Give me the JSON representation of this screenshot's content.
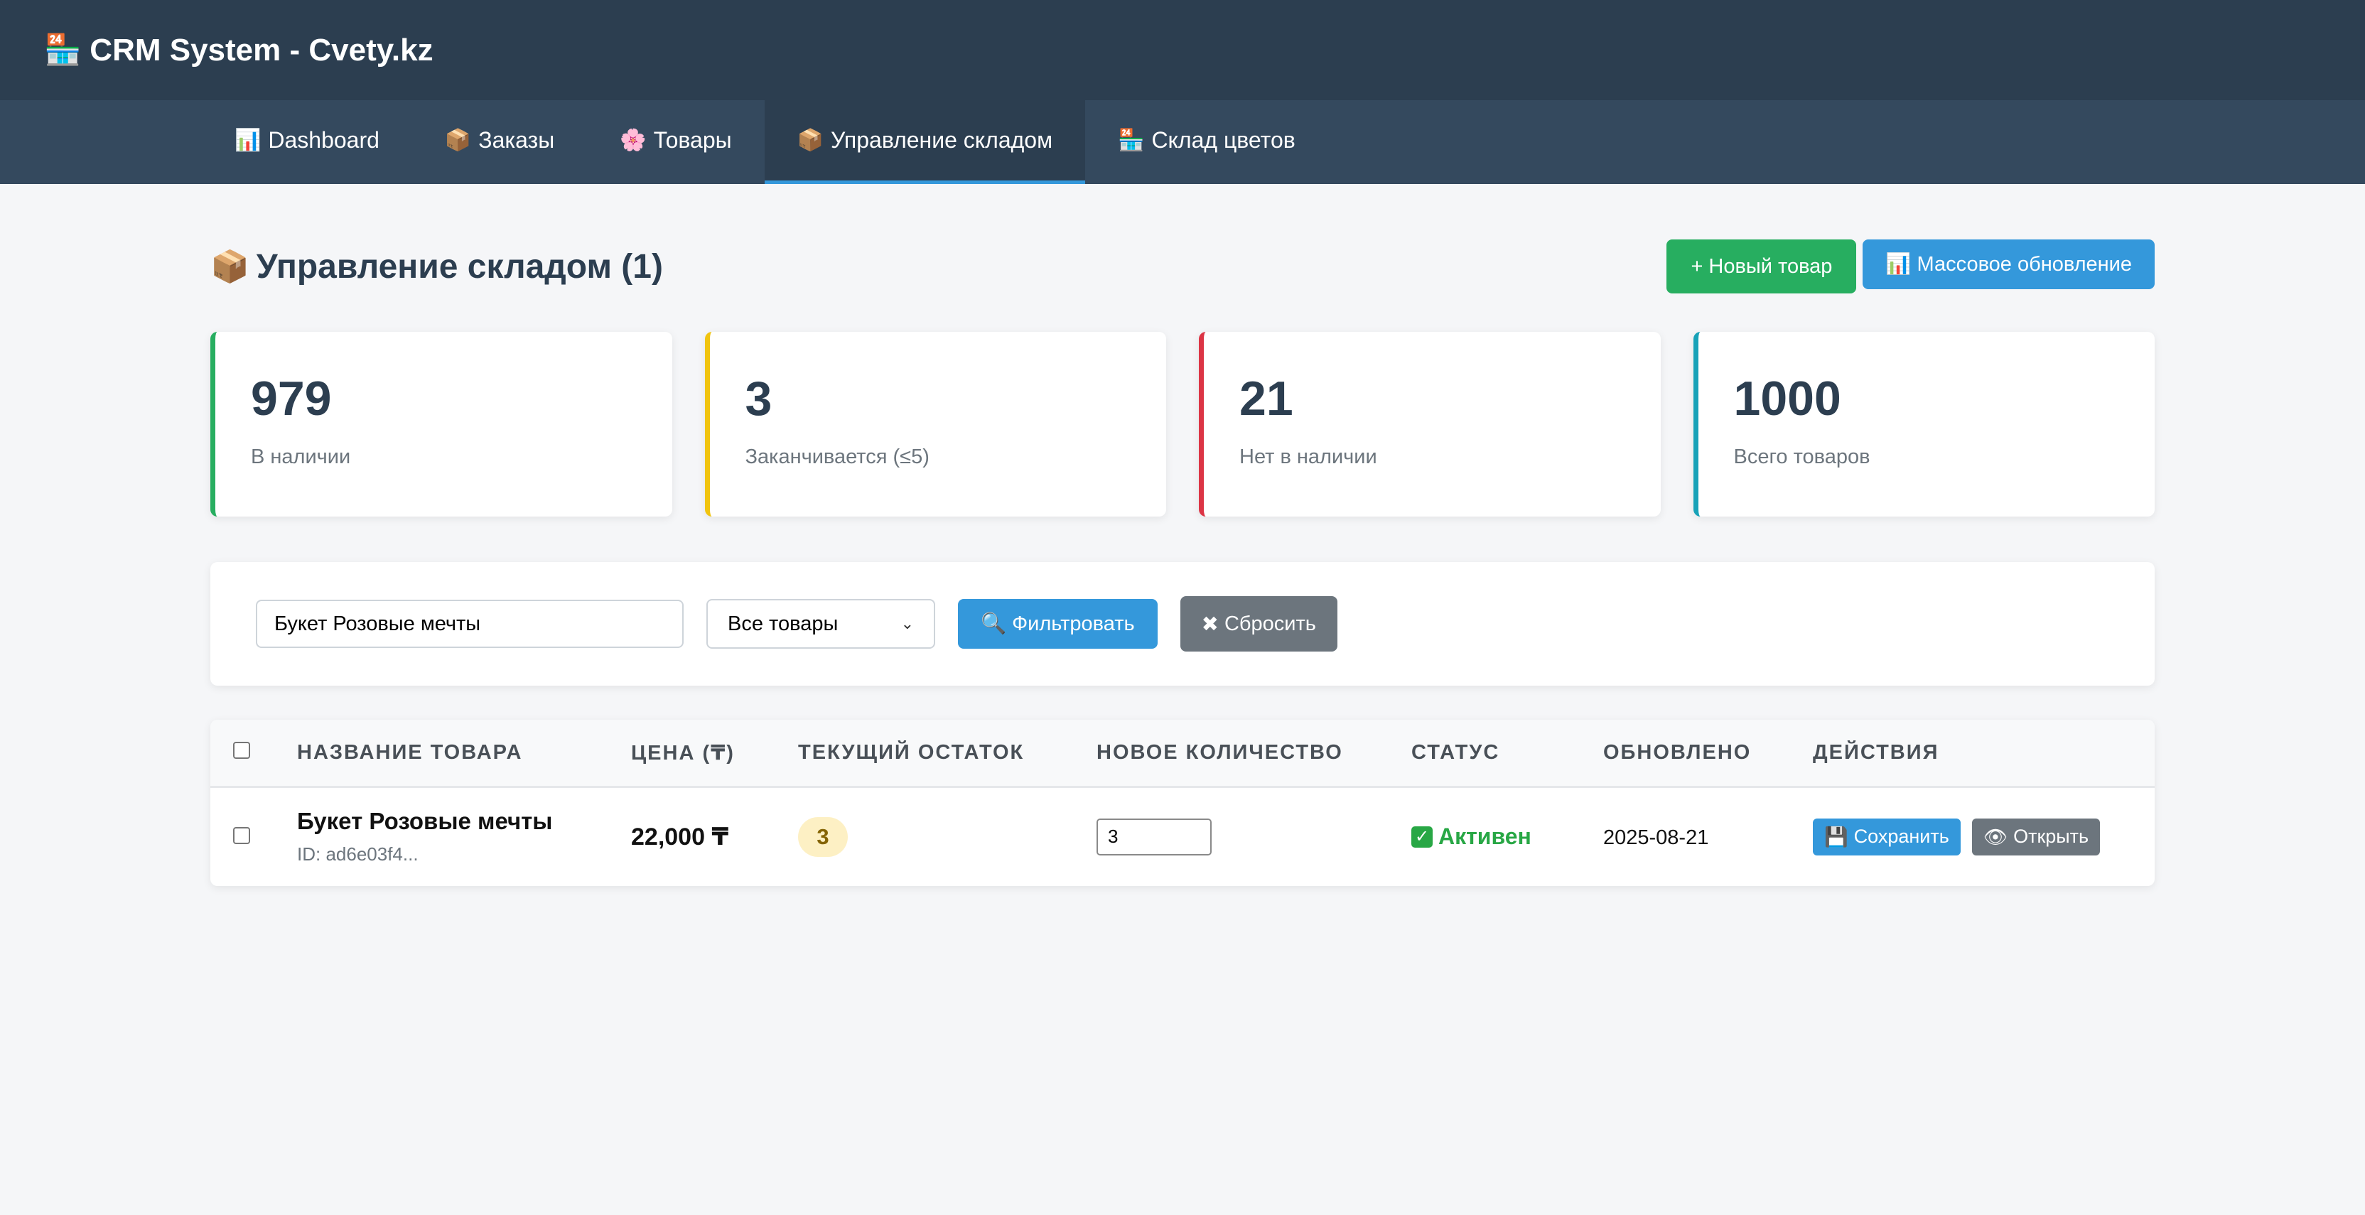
{
  "app": {
    "icon": "🏪",
    "title": "CRM System - Cvety.kz"
  },
  "nav": [
    {
      "icon": "📊",
      "label": "Dashboard",
      "active": false
    },
    {
      "icon": "📦",
      "label": "Заказы",
      "active": false
    },
    {
      "icon": "🌸",
      "label": "Товары",
      "active": false
    },
    {
      "icon": "📦",
      "label": "Управление складом",
      "active": true
    },
    {
      "icon": "🏪",
      "label": "Склад цветов",
      "active": false
    }
  ],
  "page": {
    "icon": "📦",
    "title": "Управление складом (1)",
    "new_product": {
      "icon": "+",
      "label": "Новый товар"
    },
    "bulk_update": {
      "icon": "📊",
      "label": "Массовое обновление"
    }
  },
  "stats": [
    {
      "value": "979",
      "label": "В наличии",
      "color": "#27ae60"
    },
    {
      "value": "3",
      "label": "Заканчивается (≤5)",
      "color": "#f1c40f"
    },
    {
      "value": "21",
      "label": "Нет в наличии",
      "color": "#dc3545"
    },
    {
      "value": "1000",
      "label": "Всего товаров",
      "color": "#17a2b8"
    }
  ],
  "filter": {
    "search_value": "Букет Розовые мечты",
    "select_value": "Все товары",
    "filter_button": {
      "icon": "🔍",
      "label": "Фильтровать"
    },
    "reset_button": {
      "icon": "✖",
      "label": "Сбросить"
    }
  },
  "table": {
    "headers": [
      "НАЗВАНИЕ ТОВАРА",
      "ЦЕНА (₸)",
      "ТЕКУЩИЙ ОСТАТОК",
      "НОВОЕ КОЛИЧЕСТВО",
      "СТАТУС",
      "ОБНОВЛЕНО",
      "ДЕЙСТВИЯ"
    ],
    "rows": [
      {
        "name": "Букет Розовые мечты",
        "id": "ID: ad6e03f4...",
        "price": "22,000 ₸",
        "stock": "3",
        "new_qty": "3",
        "status_icon": "✓",
        "status": "Активен",
        "updated": "2025-08-21",
        "save": {
          "icon": "💾",
          "label": "Сохранить"
        },
        "open": {
          "icon": "👁",
          "label": "Открыть"
        }
      }
    ]
  },
  "colors": {
    "header_bg": "#2c3e50",
    "nav_bg": "#34495e",
    "accent": "#3498db",
    "success": "#27ae60"
  }
}
